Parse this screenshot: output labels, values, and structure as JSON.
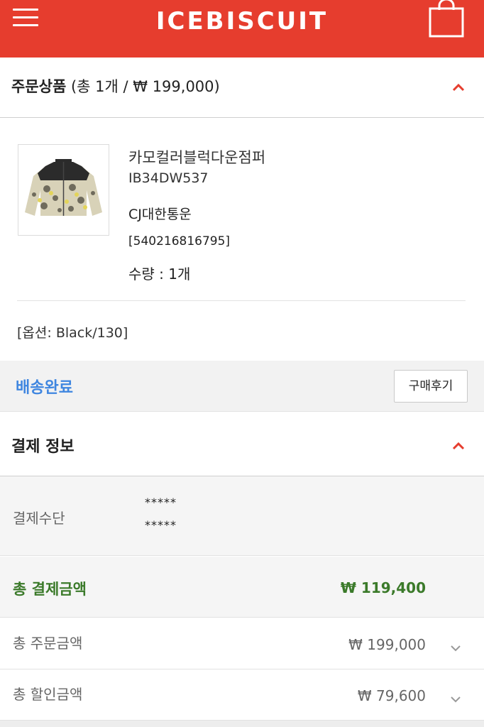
{
  "header": {
    "logo": "ICEBISCUIT",
    "bg_color": "#e63d2e",
    "menu_icon": "hamburger-menu-icon",
    "cart_icon": "shopping-bag-icon"
  },
  "order_section": {
    "title_bold": "주문상품",
    "title_summary": " (총 1개 / ₩ 199,000)",
    "toggle_icon": "chevron-up-icon"
  },
  "product": {
    "image": "camo-down-jacket-image",
    "name": "카모컬러블럭다운점퍼",
    "code": "IB34DW537",
    "courier": "CJ대한통운",
    "tracking": "[540216816795]",
    "quantity": "수량 : 1개",
    "option": "[옵션: Black/130]"
  },
  "shipping": {
    "status": "배송완료",
    "status_color": "#3f86e0",
    "review_button": "구매후기"
  },
  "payment": {
    "title": "결제 정보",
    "toggle_icon": "chevron-up-icon",
    "method_label": "결제수단",
    "method_line1": "*****",
    "method_line2": "*****",
    "total_label": "총 결제금액",
    "total_amount": "₩ 119,400",
    "total_color": "#3b7a2a",
    "rows": [
      {
        "label": "총 주문금액",
        "amount": "₩ 199,000",
        "icon": "chevron-down-icon"
      },
      {
        "label": "총 할인금액",
        "amount": "₩ 79,600",
        "icon": "chevron-down-icon"
      }
    ]
  },
  "accent_color": "#e63d2e"
}
